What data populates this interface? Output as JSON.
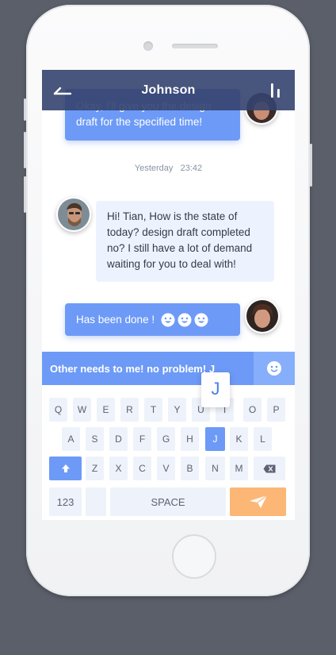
{
  "header": {
    "title": "Johnson"
  },
  "messages": [
    {
      "id": "m1",
      "direction": "out",
      "lines": [
        "Okay, I'll give you the design",
        "draft for the specified time!"
      ]
    },
    {
      "id": "m2",
      "direction": "in",
      "lines": [
        "Hi! Tian, How is the state of",
        "today? design draft completed",
        "no? I still have a lot of demand",
        "waiting for you to deal with!"
      ]
    },
    {
      "id": "m3",
      "direction": "out",
      "text": "Has been done !",
      "emojis": [
        "smile-emoji-icon",
        "smile-emoji-icon",
        "smile-emoji-icon"
      ]
    }
  ],
  "timestamp": {
    "day": "Yesterday",
    "time": "23:42"
  },
  "input": {
    "value": "Other needs to me! no problem!",
    "typed_char": "J"
  },
  "keyboard": {
    "row1": [
      "Q",
      "W",
      "E",
      "R",
      "T",
      "Y",
      "U",
      "I",
      "O",
      "P"
    ],
    "row2": [
      "A",
      "S",
      "D",
      "F",
      "G",
      "H",
      "J",
      "K",
      "L"
    ],
    "row3": [
      "Z",
      "X",
      "C",
      "V",
      "B",
      "N",
      "M"
    ],
    "numbers_label": "123",
    "space_label": "SPACE",
    "pressed_key": "J",
    "popup_label": "J"
  },
  "colors": {
    "header": "#34426e",
    "accent_blue": "#6d9af7",
    "incoming_bubble": "#edf3fe",
    "send_key": "#fcb776"
  },
  "icons": {
    "back": "back-arrow-icon",
    "menu": "menu-bars-icon",
    "emoji_button": "smiley-icon",
    "shift": "shift-arrow-icon",
    "backspace": "backspace-icon",
    "send": "paper-plane-icon"
  }
}
